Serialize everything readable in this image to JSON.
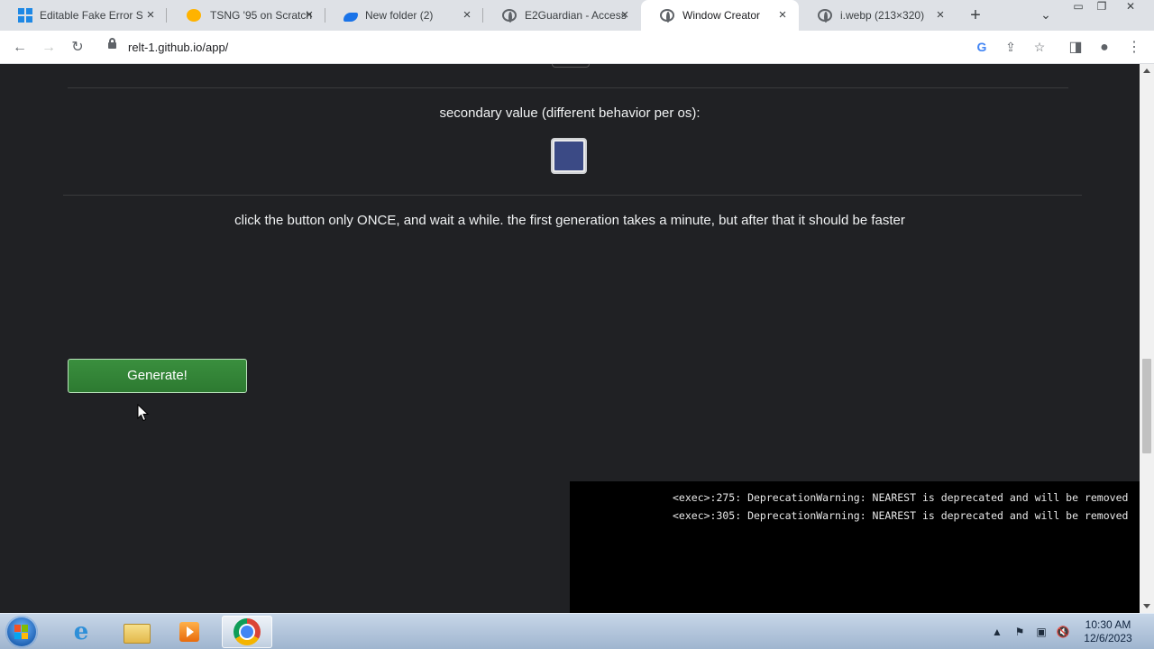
{
  "browser": {
    "tabs": [
      {
        "title": "Editable Fake Error S",
        "favicon": "windows-icon"
      },
      {
        "title": "TSNG '95 on Scratch",
        "favicon": "scratch-icon"
      },
      {
        "title": "New folder (2)",
        "favicon": "cloud-folder-icon"
      },
      {
        "title": "E2Guardian - Access",
        "favicon": "globe-icon"
      },
      {
        "title": "Window Creator",
        "favicon": "globe-icon",
        "active": true
      },
      {
        "title": "i.webp (213×320)",
        "favicon": "globe-icon"
      }
    ],
    "url": "relt-1.github.io/app/"
  },
  "page": {
    "secondary_label": "secondary value (different behavior per os):",
    "secondary_color": "#3b4a85",
    "instructions": "click the button only ONCE, and wait a while. the first generation takes a minute, but after that it should be faster",
    "generate_label": "Generate!",
    "console_lines": [
      "<exec>:275: DeprecationWarning: NEAREST is deprecated and will be removed",
      "<exec>:305: DeprecationWarning: NEAREST is deprecated and will be removed"
    ]
  },
  "taskbar": {
    "time": "10:30 AM",
    "date": "12/6/2023"
  }
}
